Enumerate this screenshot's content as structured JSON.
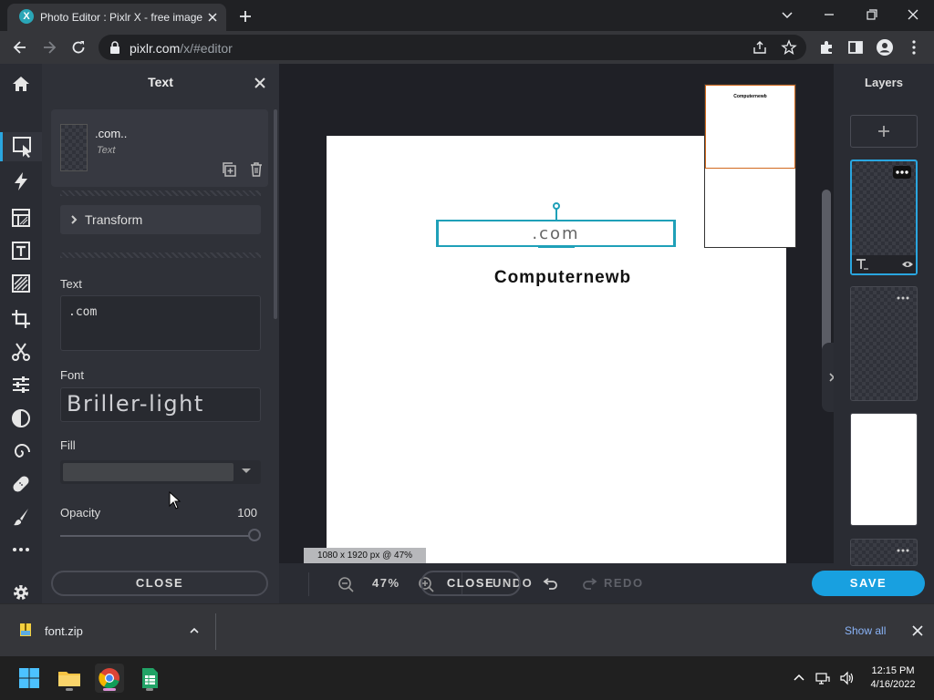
{
  "browser": {
    "tab_title": "Photo Editor : Pixlr X - free image",
    "favicon_letter": "X",
    "url_host": "pixlr.com",
    "url_path": "/x/#editor"
  },
  "toolbar": {
    "tools": [
      "home",
      "arrange",
      "auto-fix",
      "layout",
      "text",
      "elements",
      "crop",
      "cutout",
      "adjust",
      "filter",
      "liquify",
      "retouch",
      "draw",
      "more",
      "settings"
    ],
    "active": "arrange"
  },
  "panel": {
    "title": "Text",
    "layer_name": ".com..",
    "layer_type": "Text",
    "transform_label": "Transform",
    "text_label": "Text",
    "text_value": ".com",
    "font_label": "Font",
    "font_value": "Briller-light",
    "fill_label": "Fill",
    "fill_color": "#434549",
    "opacity_label": "Opacity",
    "opacity_value": "100",
    "close_label": "CLOSE"
  },
  "canvas": {
    "headline": "Computernewb",
    "selected_text": ".com",
    "dimensions": "1080 x 1920 px @ 47%",
    "navigator_text": "Computernewb"
  },
  "bottombar": {
    "zoom": "47%",
    "undo_label": "UNDO",
    "redo_label": "REDO",
    "close_label": "CLOSE",
    "save_label": "SAVE"
  },
  "layers": {
    "title": "Layers"
  },
  "shelf": {
    "file_name": "font.zip",
    "show_all": "Show all"
  },
  "taskbar": {
    "time": "12:15 PM",
    "date": "4/16/2022"
  },
  "colors": {
    "accent": "#18a0e0",
    "selection": "#1fa0b8",
    "panel_bg": "#2f3138"
  }
}
